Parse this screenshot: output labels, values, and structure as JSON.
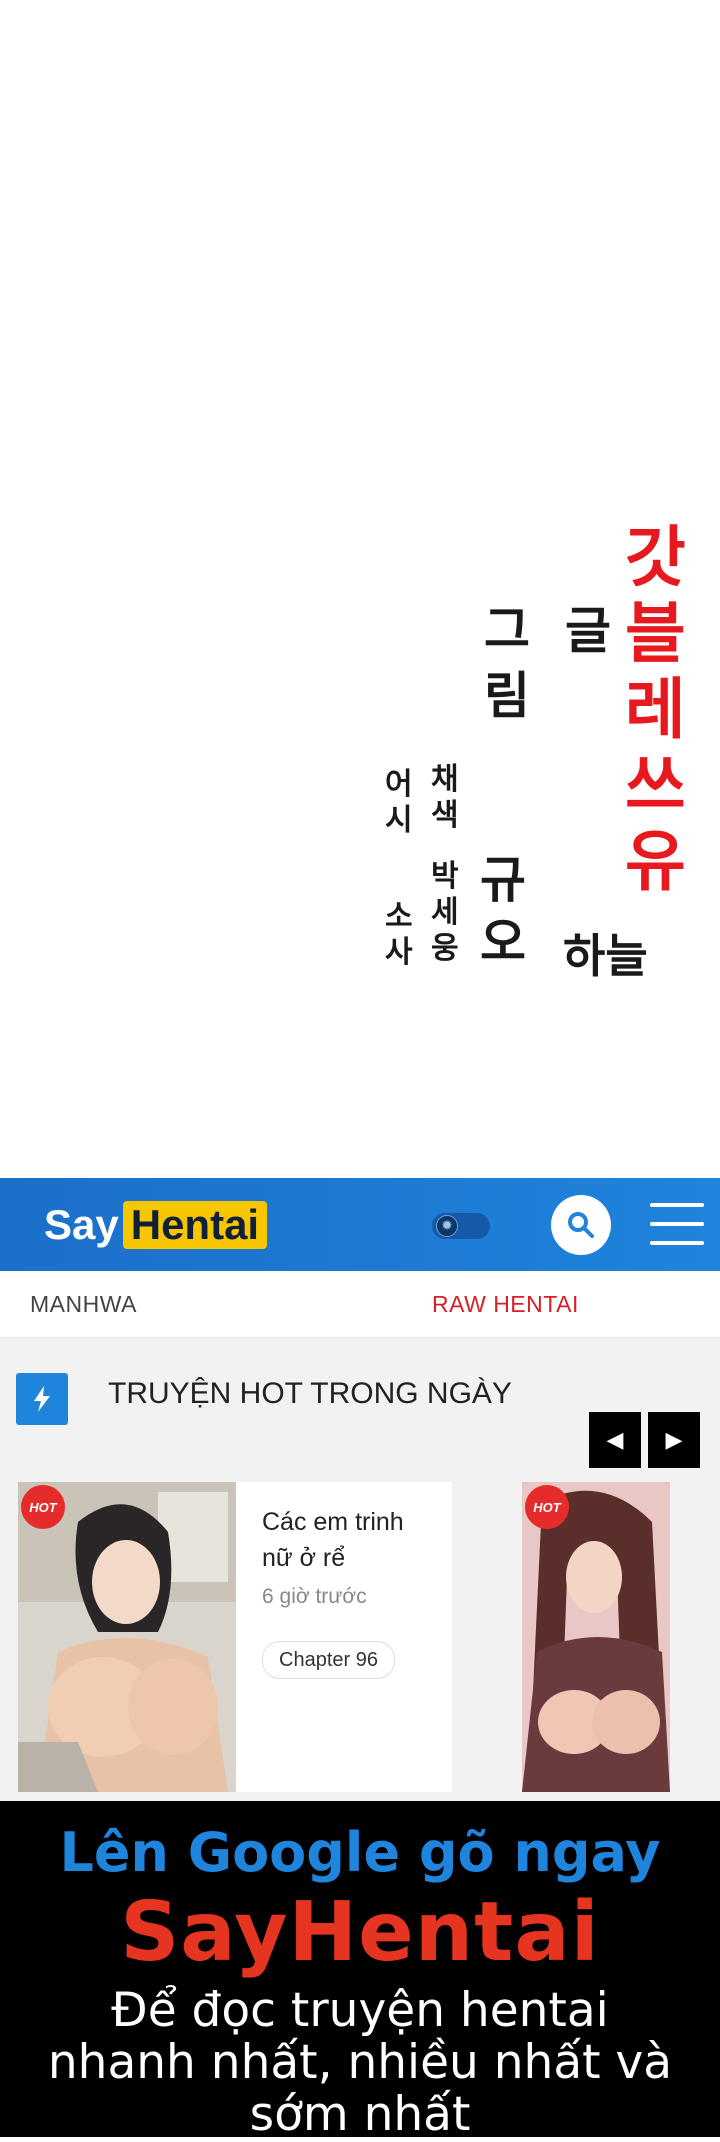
{
  "credits": {
    "title_chars": [
      "갓",
      "블",
      "레",
      "쓰",
      "유"
    ],
    "story_label_chars": [
      "글"
    ],
    "story_name": "하늘",
    "art_label_chars": [
      "그",
      "림"
    ],
    "art_name_chars": [
      "규",
      "오"
    ],
    "color_label": [
      "채",
      "색"
    ],
    "color_names": [
      "박",
      "세",
      "웅"
    ],
    "assistant_label": [
      "어",
      "시"
    ],
    "assistant_names": [
      "소",
      "사"
    ]
  },
  "header": {
    "logo_say": "Say",
    "logo_hentai": "Hentai",
    "search_icon": "search-icon",
    "menu_icon": "hamburger-menu-icon",
    "toggle_icon": "theme-toggle-icon"
  },
  "nav": {
    "items": [
      "MANHWA",
      "RAW HENTAI"
    ]
  },
  "hot": {
    "title": "TRUYỆN HOT TRONG NGÀY",
    "prev_label": "◀",
    "next_label": "▶",
    "cards": [
      {
        "badge": "HOT",
        "title": "Các em trinh nữ ở rể",
        "time": "6 giờ trước",
        "chapter": "Chapter 96"
      },
      {
        "badge": "HOT"
      }
    ]
  },
  "promo": {
    "line1": "Lên Google gõ ngay",
    "line2": "SayHentai",
    "line3a": "Để đọc truyện hentai",
    "line3b": "nhanh nhất, nhiều nhất và",
    "line3c": "sớm nhất"
  },
  "colors": {
    "brand_blue": "#1f84dc",
    "brand_yellow": "#f7c600",
    "accent_red": "#d71f26",
    "title_red": "#e8191e"
  }
}
